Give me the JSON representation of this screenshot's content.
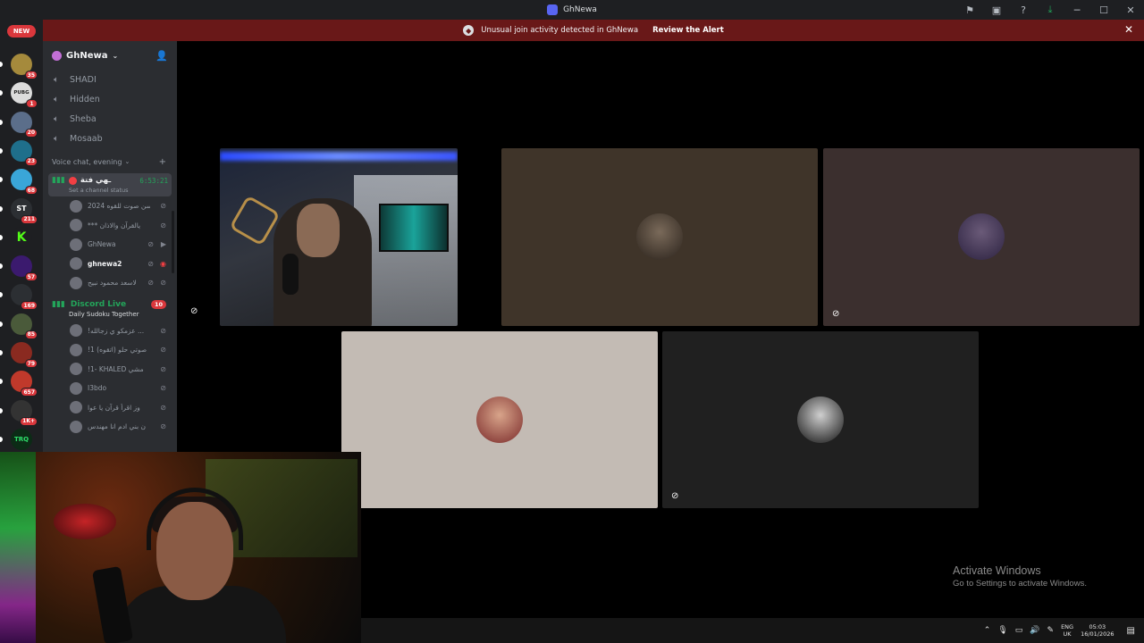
{
  "window": {
    "title": "GhNewa"
  },
  "alert": {
    "text": "Unusual join activity detected in GhNewa",
    "action": "Review the Alert"
  },
  "rail": {
    "new_label": "NEW",
    "servers": [
      {
        "badge": "35",
        "color": "#a58a3c",
        "glyph": ""
      },
      {
        "badge": "1",
        "color": "#dcdcdc",
        "glyph": "PUBG"
      },
      {
        "badge": "20",
        "color": "#5b6e8a",
        "glyph": ""
      },
      {
        "badge": "23",
        "color": "#1f6f8b",
        "glyph": ""
      },
      {
        "badge": "68",
        "color": "#3aa6d8",
        "glyph": ""
      },
      {
        "badge": "211",
        "color": "#2c2f33",
        "glyph": "ST"
      },
      {
        "badge": "",
        "color": "#1e1f22",
        "glyph": "K"
      },
      {
        "badge": "57",
        "color": "#3b1a6e",
        "glyph": ""
      },
      {
        "badge": "169",
        "color": "#2c2f33",
        "glyph": ""
      },
      {
        "badge": "85",
        "color": "#4a5a3a",
        "glyph": ""
      },
      {
        "badge": "79",
        "color": "#8a2a20",
        "glyph": ""
      },
      {
        "badge": "657",
        "color": "#c0392b",
        "glyph": ""
      },
      {
        "badge": "1K+",
        "color": "#333",
        "glyph": ""
      },
      {
        "badge": "",
        "color": "#0c2b16",
        "glyph": "TRQ"
      }
    ]
  },
  "guild": {
    "name": "GhNewa"
  },
  "voice_channels": [
    "SHADI",
    "Hidden",
    "Sheba",
    "Mosaab"
  ],
  "category": "Voice chat, evening",
  "active_channel": {
    "name": "ـهي فتة",
    "timer": "6:53:21",
    "status": "Set a channel status"
  },
  "members": [
    {
      "name": "احسن صوت للقوه 2024 !",
      "icon": "",
      "icon2": ""
    },
    {
      "name": "*** يالقرآن والاذان",
      "icon": "",
      "icon2": ""
    },
    {
      "name": "GhNewa",
      "icon": "▶",
      "icon2": ""
    },
    {
      "name": "ghnewa2",
      "icon": "◉",
      "icon2": "",
      "bold": true
    },
    {
      "name": "لاسعد محمود نبيح",
      "icon": "",
      "icon2": ""
    }
  ],
  "discord_live": {
    "name": "Discord Live",
    "count": "10",
    "activity": "Daily Sudoku Together"
  },
  "live_members": [
    {
      "name": "!عزمكو ي زجالله ... "
    },
    {
      "name": "!1 صوتي حلو (اتقوه)"
    },
    {
      "name": "!1- KHALED مشي"
    },
    {
      "name": "I3bdo"
    },
    {
      "name": "وز اقرأ قرآن يا عوا"
    },
    {
      "name": "ن بني ادم انا مهندس"
    }
  ],
  "watermark": {
    "line1": "Activate Windows",
    "line2": "Go to Settings to activate Windows."
  },
  "taskbar": {
    "lang_top": "ENG",
    "lang_bottom": "UK",
    "time": "05:03",
    "date": "16/01/2026"
  },
  "colors": {
    "alert_bg": "#691818",
    "sidebar_bg": "#2b2d31",
    "live_green": "#23a55a",
    "badge_red": "#da373c"
  }
}
